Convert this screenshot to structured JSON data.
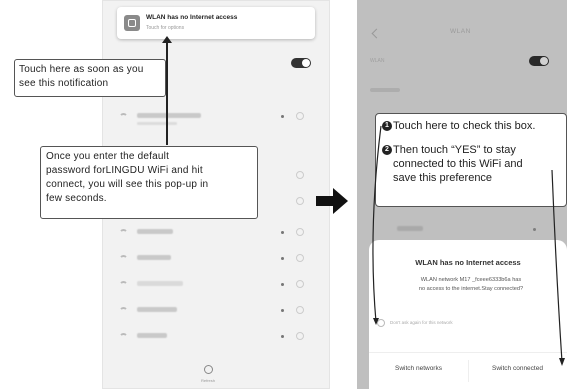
{
  "left_phone": {
    "notification": {
      "title": "WLAN has no Internet access",
      "subtitle": "Touch for options"
    },
    "refresh_label": "Refresh"
  },
  "callout_top": {
    "lines": [
      "Touch here as soon as you",
      "see this notification"
    ]
  },
  "callout_mid": {
    "lines": [
      "Once you enter the default",
      "password forLINGDU WiFi and hit",
      "connect, you will see this pop-up in",
      "few seconds."
    ]
  },
  "right_phone": {
    "title": "WLAN",
    "wlan_row": "WLAN",
    "dialog": {
      "title": "WLAN has no Internet access",
      "body_line1": "WLAN network  M17  _fceee6333b6a has",
      "body_line2": "no access to the internet.Stay connected?",
      "checkbox_label": "Don't ask again for this network",
      "switch_networks": "Switch networks",
      "switch_connected": "Switch connected"
    }
  },
  "instructions": {
    "step1_number": "1",
    "step1_text": "Touch here to check this box.",
    "step2_number": "2",
    "step2_lines": [
      "Then touch “YES” to stay",
      "connected to this WiFi and",
      "save this preference"
    ]
  }
}
